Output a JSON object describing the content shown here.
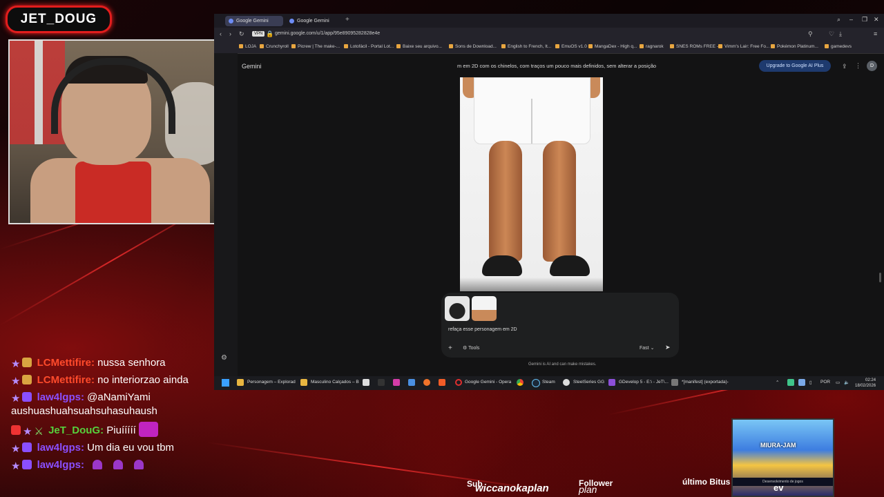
{
  "overlay": {
    "streamer_name": "JET_DOUG",
    "sub_label": "Sub",
    "sub_name": "wiccanokaplan",
    "follower_label": "Follower",
    "follower_name": "plan",
    "bits_label": "último Bitus",
    "bits_name": "ev",
    "game_title": "MIURA-JAM",
    "game_caption": "Desenvolvimento de jogos"
  },
  "chat": {
    "messages": [
      {
        "user": "LCMettifire:",
        "text": "nussa senhora",
        "color": "#ff4b2b"
      },
      {
        "user": "LCMettifire:",
        "text": "no interiorzao ainda",
        "color": "#ff4b2b"
      },
      {
        "user": "law4lgps:",
        "text": "@aNamiYami aushuashuahsuahsuhasuhaush",
        "color": "#8a4fff"
      },
      {
        "user": "JeT_DouG:",
        "text": "Piuííííí",
        "color": "#56d13d"
      },
      {
        "user": "law4lgps:",
        "text": "Um dia eu vou tbm",
        "color": "#8a4fff"
      },
      {
        "user": "law4lgps:",
        "text": "",
        "color": "#8a4fff"
      }
    ]
  },
  "browser": {
    "tabs": [
      "Google Gemini",
      "Google Gemini"
    ],
    "url": "gemini.google.com/u/1/app/95e89095282828e4e",
    "vpn": "VPN",
    "bookmarks": [
      "LOJA",
      "Crunchyroll",
      "Picrew | The make-...",
      "Lotofácil - Portal Lot...",
      "Baixe seu arquivo...",
      "Sons de Download...",
      "English to French, It...",
      "EmuOS v1.0",
      "MangaDex - High q...",
      "ragnarok",
      "SNES ROMs FREE -...",
      "Vimm's Lair: Free Fo...",
      "Pokémon Platinum...",
      "gamedevs"
    ]
  },
  "gemini": {
    "title": "Gemini",
    "prompt_heading": "m em 2D com os chinelos, com traços um pouco mais definidos, sem alterar a posição",
    "upgrade_label": "Upgrade to Google AI Plus",
    "avatar_letter": "D",
    "composer_text": "refaça esse personagem em 2D",
    "tools_label": "Tools",
    "fast_label": "Fast",
    "disclaimer": "Gemini is AI and can make mistakes."
  },
  "taskbar": {
    "items": [
      "Personagem – Explorad",
      "Masculino Calçados – B",
      "Google Gemini - Opera",
      "Steam",
      "SteelSeries GG",
      "GDevelop 5 - E:\\ - JeT\\...",
      "*[manifest] (exportada)-"
    ],
    "lang": "POR",
    "time": "02:24",
    "date": "18/02/2026"
  }
}
